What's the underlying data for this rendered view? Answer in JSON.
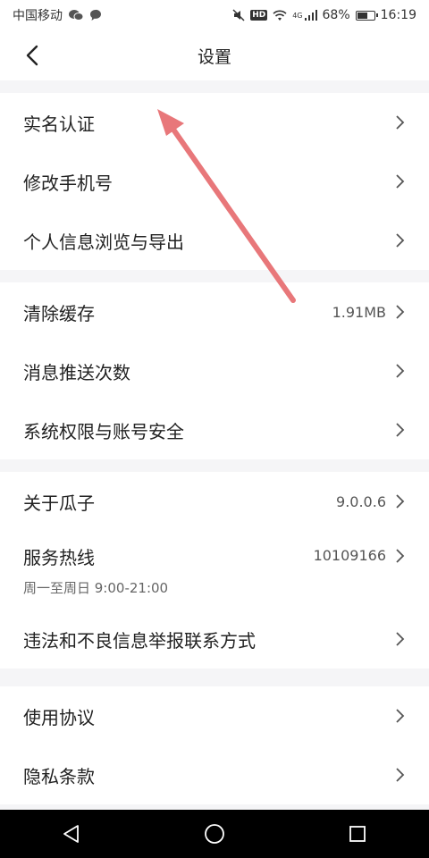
{
  "status_bar": {
    "carrier": "中国移动",
    "network_badge": "HD",
    "cell_label": "4G",
    "battery_text": "68%",
    "battery_level": 0.68,
    "time": "16:19"
  },
  "header": {
    "title": "设置"
  },
  "groups": [
    {
      "items": [
        {
          "label": "实名认证",
          "value": ""
        },
        {
          "label": "修改手机号",
          "value": ""
        },
        {
          "label": "个人信息浏览与导出",
          "value": ""
        }
      ]
    },
    {
      "items": [
        {
          "label": "清除缓存",
          "value": "1.91MB"
        },
        {
          "label": "消息推送次数",
          "value": ""
        },
        {
          "label": "系统权限与账号安全",
          "value": ""
        }
      ]
    },
    {
      "items": [
        {
          "label": "关于瓜子",
          "value": "9.0.0.6"
        },
        {
          "label": "服务热线",
          "value": "10109166",
          "sub": "周一至周日 9:00-21:00"
        },
        {
          "label": "违法和不良信息举报联系方式",
          "value": ""
        }
      ]
    },
    {
      "items": [
        {
          "label": "使用协议",
          "value": ""
        },
        {
          "label": "隐私条款",
          "value": ""
        }
      ]
    }
  ],
  "colors": {
    "background": "#f5f5f7",
    "annotation_arrow": "#e8777a"
  },
  "icons": {
    "back": "chevron-left-icon",
    "row_arrow": "chevron-right-icon",
    "sys_back": "triangle-back-icon",
    "sys_home": "circle-home-icon",
    "sys_recent": "square-recent-icon"
  }
}
